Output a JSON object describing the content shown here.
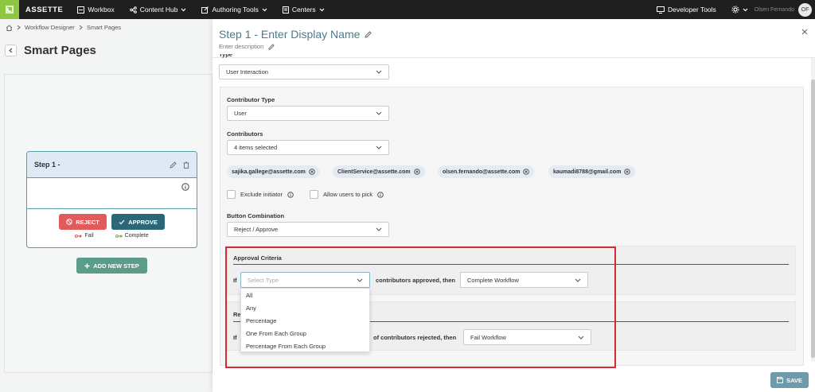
{
  "nav": {
    "brand": "ASSETTE",
    "items": [
      {
        "label": "Workbox"
      },
      {
        "label": "Content Hub"
      },
      {
        "label": "Authoring Tools"
      },
      {
        "label": "Centers"
      }
    ],
    "developer_tools": "Developer Tools",
    "user_name": "Olsen Fernando",
    "avatar_initials": "OF"
  },
  "breadcrumb": {
    "items": [
      "Workflow Designer",
      "Smart Pages"
    ]
  },
  "page_title": "Smart Pages",
  "step_card": {
    "title": "Step 1 -",
    "reject_label": "REJECT",
    "approve_label": "APPROVE",
    "fail_label": "Fail",
    "complete_label": "Complete"
  },
  "add_step_label": "ADD NEW STEP",
  "panel": {
    "title": "Step 1 - Enter Display Name",
    "description": "Enter description",
    "type_label": "Type",
    "type_value": "User Interaction",
    "contributor_type_label": "Contributor Type",
    "contributor_type_value": "User",
    "contributors_label": "Contributors",
    "contributors_value": "4 items selected",
    "chips": [
      "sajika.gallege@assette.com",
      "ClientService@assette.com",
      "olsen.fernando@assette.com",
      "kaumadi8788@gmail.com"
    ],
    "exclude_initiator": "Exclude initiator",
    "allow_users_pick": "Allow users to pick",
    "button_combination_label": "Button Combination",
    "button_combination_value": "Reject / Approve",
    "approval_criteria_label": "Approval Criteria",
    "if_label": "If",
    "select_type_placeholder": "Select Type",
    "approved_then": "contributors approved, then",
    "approved_action": "Complete Workflow",
    "rejection_label_partial": "Re",
    "rejected_then": "of contributors rejected, then",
    "rejected_action": "Fail Workflow",
    "dropdown_options": [
      "All",
      "Any",
      "Percentage",
      "One From Each Group",
      "Percentage From Each Group"
    ],
    "save_label": "SAVE"
  },
  "colors": {
    "nav_bg": "#1f1f1f",
    "logo_green": "#8dc63f",
    "accent_teal": "#2c6778",
    "reject_red": "#e35a5a",
    "highlight_red": "#d62b35"
  }
}
